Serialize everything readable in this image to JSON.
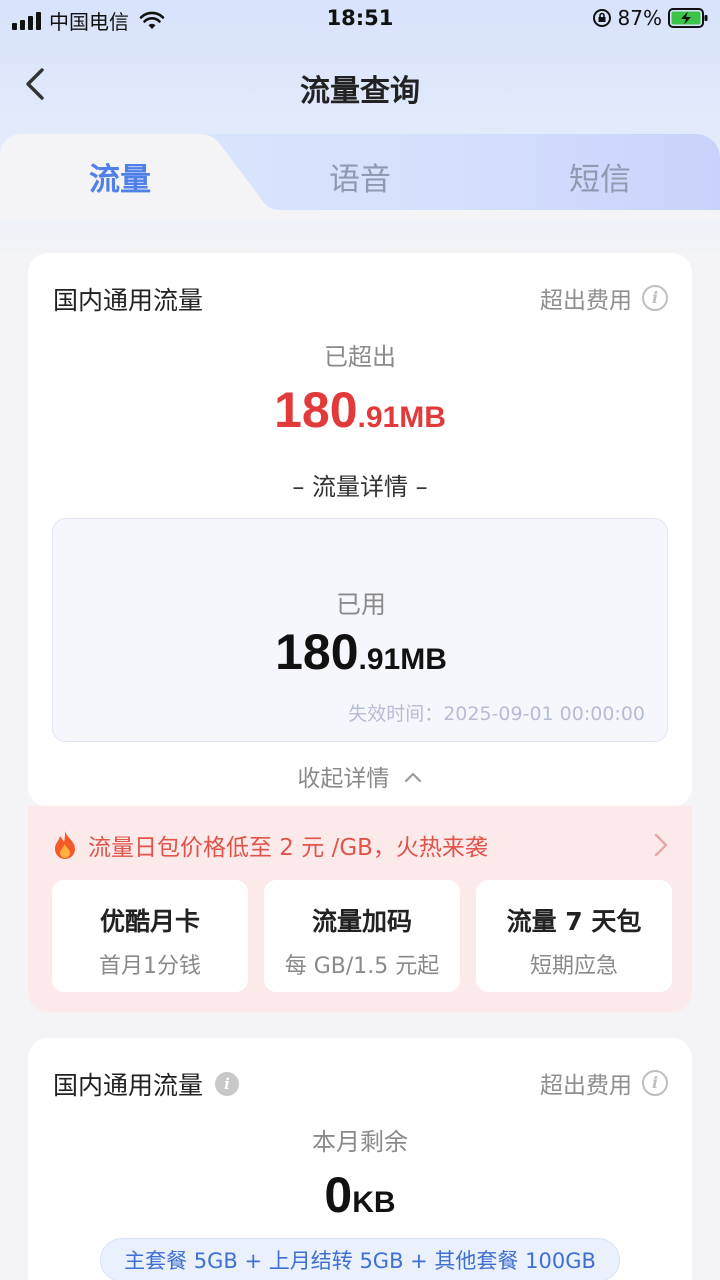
{
  "status_bar": {
    "carrier": "中国电信",
    "time": "18:51",
    "battery_percent": "87%"
  },
  "nav": {
    "title": "流量查询"
  },
  "tabs": [
    {
      "label": "流量",
      "active": true
    },
    {
      "label": "语音",
      "active": false
    },
    {
      "label": "短信",
      "active": false
    }
  ],
  "usage_card": {
    "title": "国内通用流量",
    "exceed_fee_label": "超出费用",
    "exceeded_label": "已超出",
    "exceeded_value_int": "180",
    "exceeded_value_dec": ".91MB",
    "detail_heading": "– 流量详情 –",
    "used_label": "已用",
    "used_value_int": "180",
    "used_value_dec": ".91MB",
    "expire_label": "失效时间：",
    "expire_value": "2025-09-01 00:00:00",
    "collapse_label": "收起详情"
  },
  "promo": {
    "headline": "流量日包价格低至 2 元 /GB，火热来袭",
    "items": [
      {
        "title": "优酷月卡",
        "subtitle": "首月1分钱"
      },
      {
        "title": "流量加码",
        "subtitle": "每 GB/1.5 元起"
      },
      {
        "title": "流量 7 天包",
        "subtitle": "短期应急"
      }
    ]
  },
  "remain_card": {
    "title": "国内通用流量",
    "exceed_fee_label": "超出费用",
    "remain_label": "本月剩余",
    "remain_value_int": "0",
    "remain_value_dec": "KB",
    "plan_summary": "主套餐 5GB + 上月结转 5GB + 其他套餐 100GB"
  },
  "colors": {
    "accent_blue": "#4f7fe9",
    "alert_red": "#e23a3a",
    "promo_bg": "#fce9ea"
  }
}
